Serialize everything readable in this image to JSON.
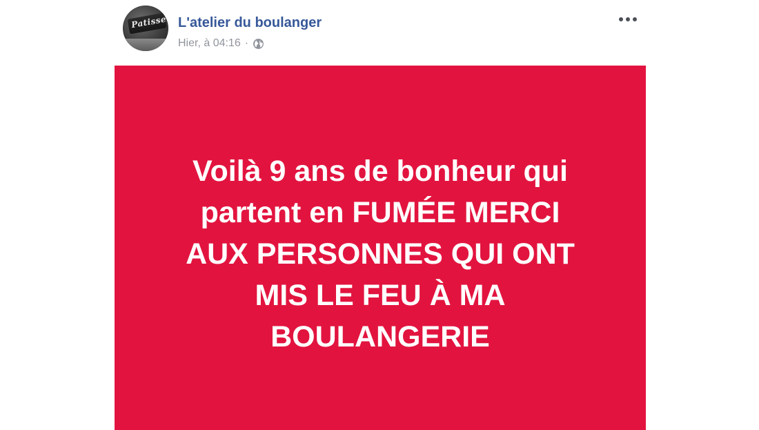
{
  "post": {
    "page_name": "L'atelier du boulanger",
    "timestamp": "Hier, à 04:16",
    "separator": "·",
    "privacy_icon": "globe-icon",
    "avatar_sign_text": "Patisse",
    "options_icon": "more-options-icon",
    "image": {
      "background_color": "#e2143f",
      "text_color": "#ffffff",
      "lines": [
        "Voilà 9 ans de bonheur qui",
        "partent en FUMÉE MERCI",
        "AUX PERSONNES QUI ONT",
        "MIS LE FEU À MA",
        "BOULANGERIE"
      ]
    }
  }
}
